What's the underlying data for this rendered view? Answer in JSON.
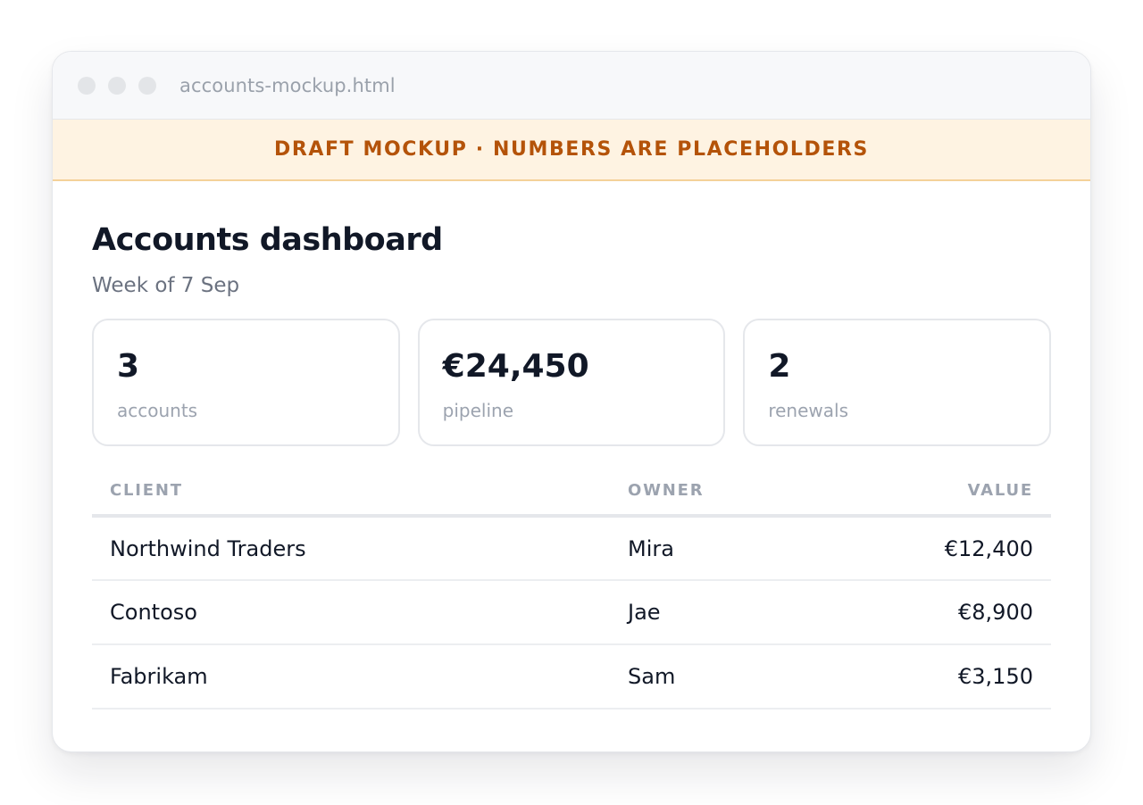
{
  "window": {
    "title": "accounts-mockup.html"
  },
  "banner": {
    "text": "DRAFT MOCKUP · NUMBERS ARE PLACEHOLDERS"
  },
  "page": {
    "title": "Accounts dashboard",
    "subtitle": "Week of 7 Sep"
  },
  "stats": [
    {
      "value": "3",
      "label": "accounts"
    },
    {
      "value": "€24,450",
      "label": "pipeline"
    },
    {
      "value": "2",
      "label": "renewals"
    }
  ],
  "table": {
    "headers": {
      "client": "CLIENT",
      "owner": "OWNER",
      "value": "VALUE"
    },
    "rows": [
      {
        "client": "Northwind Traders",
        "owner": "Mira",
        "value": "€12,400"
      },
      {
        "client": "Contoso",
        "owner": "Jae",
        "value": "€8,900"
      },
      {
        "client": "Fabrikam",
        "owner": "Sam",
        "value": "€3,150"
      }
    ]
  },
  "colors": {
    "banner_bg": "#fef3e2",
    "banner_text": "#b45309",
    "text_primary": "#111827",
    "text_muted": "#9ca3af"
  }
}
